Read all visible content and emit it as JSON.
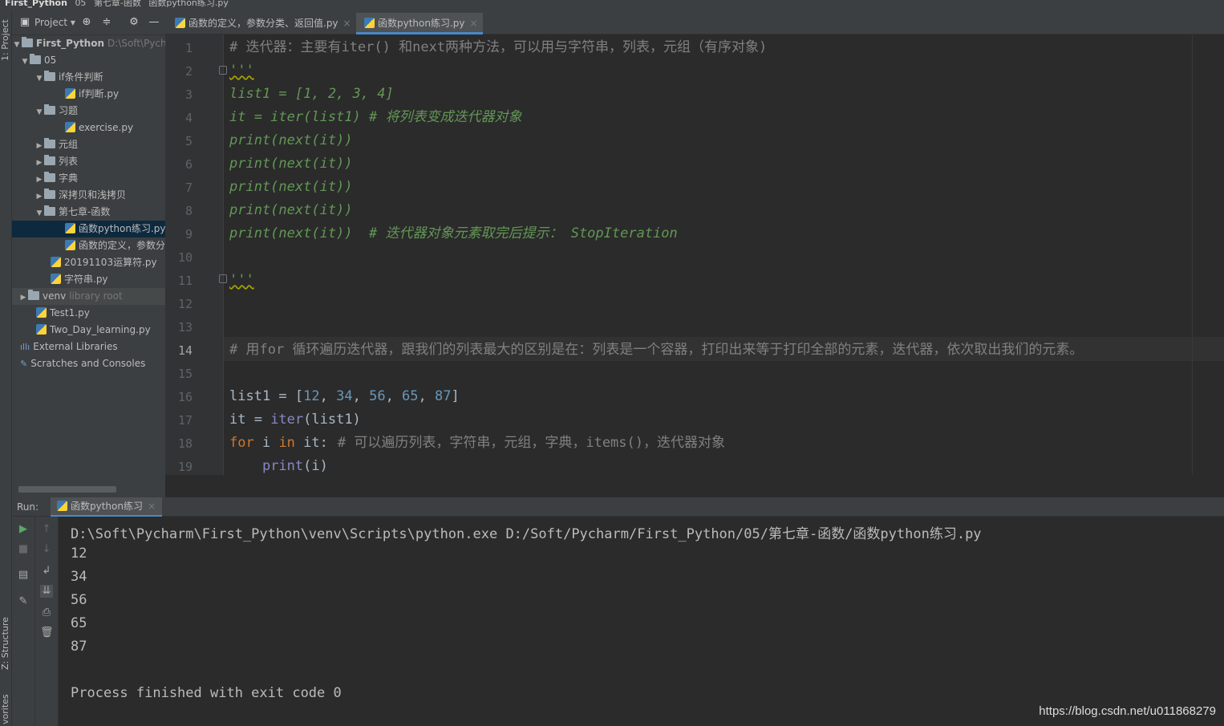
{
  "breadcrumb": {
    "project": "First_Python",
    "items": [
      "05",
      "第七章-函数",
      "函数python练习.py"
    ]
  },
  "side_tabs": {
    "project": "1: Project",
    "structure": "Z: Structure",
    "favorites": "vorites"
  },
  "project_panel": {
    "title": "Project",
    "tree": [
      {
        "label": "First_Python",
        "hint": "D:\\Soft\\Pycharm",
        "arrow": "▼"
      },
      {
        "label": "05",
        "arrow": "▼"
      },
      {
        "label": "if条件判断",
        "arrow": "▼"
      },
      {
        "label": "if判断.py",
        "arrow": ""
      },
      {
        "label": "习题",
        "arrow": "▼"
      },
      {
        "label": "exercise.py",
        "arrow": ""
      },
      {
        "label": "元组",
        "arrow": "▶"
      },
      {
        "label": "列表",
        "arrow": "▶"
      },
      {
        "label": "字典",
        "arrow": "▶"
      },
      {
        "label": "深拷贝和浅拷贝",
        "arrow": "▶"
      },
      {
        "label": "第七章-函数",
        "arrow": "▼"
      },
      {
        "label": "函数python练习.py",
        "arrow": ""
      },
      {
        "label": "函数的定义，参数分",
        "arrow": ""
      },
      {
        "label": "20191103运算符.py",
        "arrow": ""
      },
      {
        "label": "字符串.py",
        "arrow": ""
      },
      {
        "label": "venv",
        "hint": "library root",
        "arrow": "▶"
      },
      {
        "label": "Test1.py",
        "arrow": ""
      },
      {
        "label": "Two_Day_learning.py",
        "arrow": ""
      },
      {
        "label": "External Libraries",
        "arrow": ""
      },
      {
        "label": "Scratches and Consoles",
        "arrow": ""
      }
    ]
  },
  "editor_tabs": [
    {
      "label": "函数的定义，参数分类、返回值.py",
      "close": "×"
    },
    {
      "label": "函数python练习.py",
      "close": "×"
    }
  ],
  "editor": {
    "current_line": 14,
    "lines": [
      {
        "n": "1",
        "text": "# 迭代器：主要有iter() 和next两种方法，可以用与字符串，列表，元组（有序对象)"
      },
      {
        "n": "2",
        "text": "'''"
      },
      {
        "n": "3",
        "text": "list1 = [1, 2, 3, 4]"
      },
      {
        "n": "4",
        "a": "it = iter(list1) ",
        "b": "# 将列表变成迭代器对象"
      },
      {
        "n": "5",
        "text": "print(next(it))"
      },
      {
        "n": "6",
        "text": "print(next(it))"
      },
      {
        "n": "7",
        "text": "print(next(it))"
      },
      {
        "n": "8",
        "text": "print(next(it))"
      },
      {
        "n": "9",
        "a": "print(next(it))  ",
        "b": "# 迭代器对象元素取完后提示： StopIteration"
      },
      {
        "n": "10",
        "text": ""
      },
      {
        "n": "11",
        "text": "'''"
      },
      {
        "n": "12",
        "text": ""
      },
      {
        "n": "13",
        "text": ""
      },
      {
        "n": "14",
        "text": "# 用for 循环遍历迭代器，跟我们的列表最大的区别是在：列表是一个容器，打印出来等于打印全部的元素，迭代器，依次取出我们的元素。"
      },
      {
        "n": "15",
        "text": ""
      },
      {
        "n": "16",
        "var": "list1",
        "eq": " = [",
        "nums": [
          "12",
          "34",
          "56",
          "65",
          "87"
        ],
        "sep": ", ",
        "close": "]"
      },
      {
        "n": "17",
        "var": "it = ",
        "fn": "iter",
        "args": "(list1)"
      },
      {
        "n": "18",
        "kw1": "for",
        "mid1": " i ",
        "kw2": "in",
        "mid2": " it:",
        "comment": "# 可以遍历列表，字符串，元组，字典，items()，迭代器对象"
      },
      {
        "n": "19",
        "indent": "    ",
        "fn": "print",
        "args": "(i)"
      }
    ]
  },
  "run_panel": {
    "label": "Run:",
    "tab": "函数python练习",
    "close": "×",
    "output": [
      "D:\\Soft\\Pycharm\\First_Python\\venv\\Scripts\\python.exe D:/Soft/Pycharm/First_Python/05/第七章-函数/函数python练习.py",
      "12",
      "34",
      "56",
      "65",
      "87",
      "",
      "Process finished with exit code 0"
    ]
  },
  "watermark": "https://blog.csdn.net/u011868279",
  "colors": {
    "background": "#2b2b2b",
    "panel": "#3c3f41",
    "selection": "#0d293e",
    "keyword": "#cc7832",
    "number": "#6897bb",
    "comment": "#808080",
    "docstring": "#629755"
  }
}
